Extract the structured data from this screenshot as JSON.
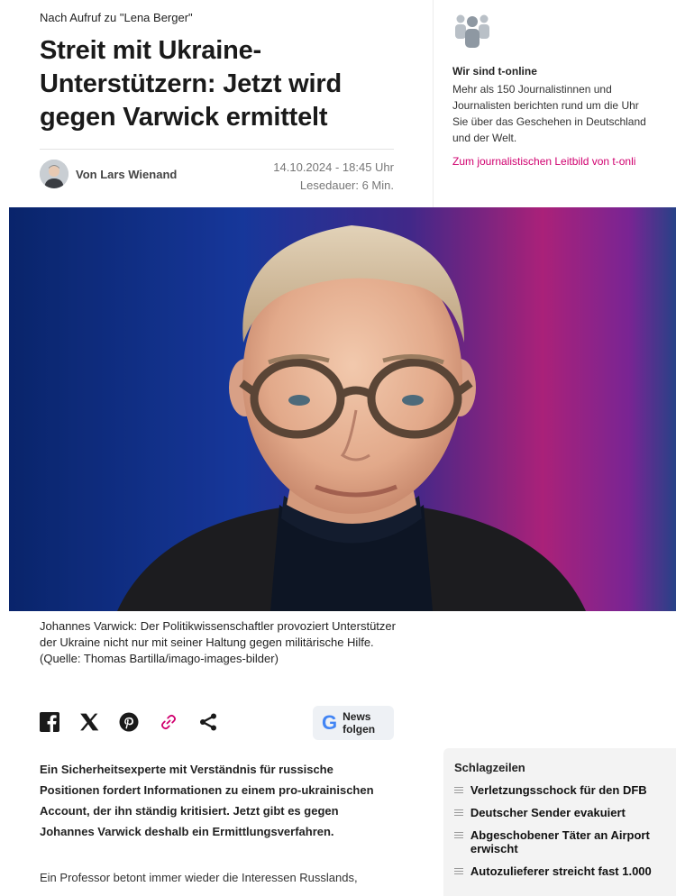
{
  "article": {
    "kicker": "Nach Aufruf zu \"Lena Berger\"",
    "headline": "Streit mit Ukraine-Unterstützern: Jetzt wird gegen Varwick ermittelt",
    "author": "Von Lars Wienand",
    "date": "14.10.2024 - 18:45 Uhr",
    "reading_time": "Lesedauer: 6 Min.",
    "caption": "Johannes Varwick: Der Politikwissenschaftler provoziert Unterstützer der Ukraine nicht nur mit seiner Haltung gegen militärische Hilfe. (Quelle: Thomas Bartilla/imago-images-bilder)",
    "lead": "Ein Sicherheitsexperte mit Verständnis für russische Positionen fordert Informationen zu einem pro-ukrainischen Account, der ihn ständig kritisiert. Jetzt gibt es gegen Johannes Varwick deshalb ein Ermittlungsverfahren.",
    "body_start": "Ein Professor betont immer wieder die Interessen Russlands,"
  },
  "share": {
    "icons": [
      "facebook-icon",
      "x-icon",
      "pinterest-icon",
      "link-icon",
      "share-icon"
    ],
    "news_label_1": "News",
    "news_label_2": "folgen",
    "google_letter": "G"
  },
  "sidebar": {
    "title": "Wir sind t-online",
    "text": "Mehr als 150 Journalistinnen und\nJournalisten berichten rund um die Uhr\nSie über das Geschehen in Deutschland\nund der Welt.",
    "link": "Zum journalistischen Leitbild von t-onli"
  },
  "headlines": {
    "title": "Schlagzeilen",
    "items": [
      "Verletzungsschock für den DFB",
      "Deutscher Sender evakuiert",
      "Abgeschobener Täter an Airport erwischt",
      "Autozulieferer streicht fast 1.000"
    ]
  },
  "colors": {
    "accent": "#d0006f",
    "text": "#1a1a1a"
  }
}
